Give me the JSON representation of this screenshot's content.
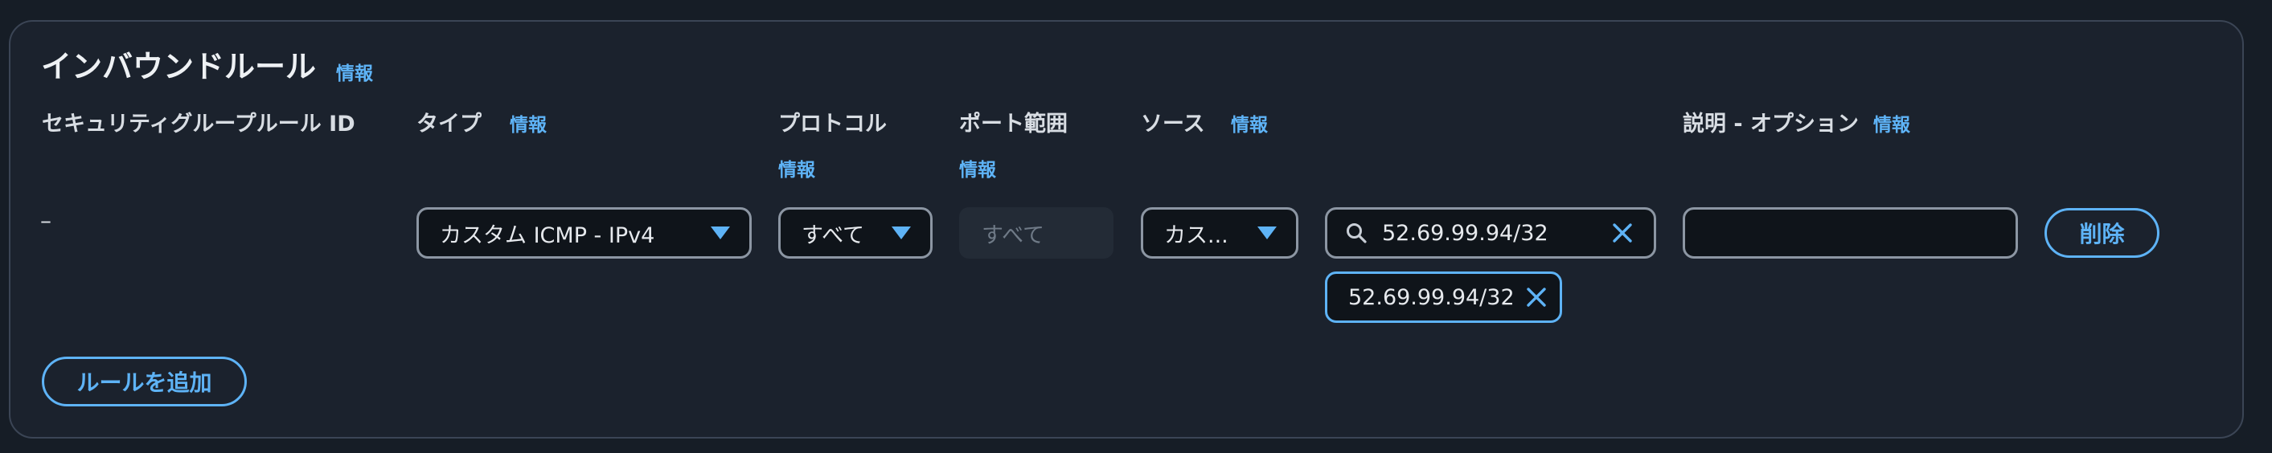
{
  "section": {
    "title": "インバウンドルール",
    "info_label": "情報"
  },
  "columns": {
    "rule_id": "セキュリティグループルール ID",
    "type": "タイプ",
    "protocol": "プロトコル",
    "port_range": "ポート範囲",
    "source": "ソース",
    "description": "説明 - オプション"
  },
  "rule": {
    "rule_id": "–",
    "type_value": "カスタム ICMP - IPv4",
    "protocol_value": "すべて",
    "port_range_placeholder": "すべて",
    "source_value": "カス...",
    "source_search_value": "52.69.99.94/32",
    "source_token": "52.69.99.94/32",
    "description_value": "",
    "delete_label": "削除"
  },
  "add_rule_label": "ルールを追加",
  "icons": {
    "dropdown": "caret-down-icon",
    "search": "search-icon",
    "clear": "close-icon"
  },
  "colors": {
    "accent": "#5eb3f6",
    "background": "#161d26",
    "panel": "#1b222d",
    "border": "#8c96a3"
  }
}
